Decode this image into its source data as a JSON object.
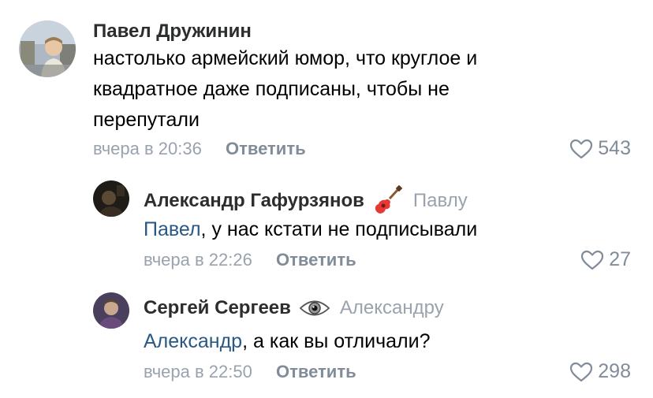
{
  "comments": [
    {
      "author": "Павел Дружинин",
      "reply_to": "",
      "mention": "",
      "text_lines": [
        "настолько армейский юмор, что круглое и",
        "квадратное даже подписаны, чтобы не",
        "перепутали"
      ],
      "time": "вчера в 20:36",
      "reply_label": "Ответить",
      "likes": "543",
      "avatar_icon": "user-photo"
    },
    {
      "author": "Александр Гафурзянов",
      "author_icon": "guitar-icon",
      "reply_to": "Павлу",
      "mention": "Павел",
      "text": ", у нас кстати не подписывали",
      "time": "вчера в 22:26",
      "reply_label": "Ответить",
      "likes": "27",
      "avatar_icon": "user-photo"
    },
    {
      "author": "Сергей Сергеев",
      "author_icon": "eye-icon",
      "reply_to": "Александру",
      "mention": "Александр",
      "text": ", а как вы отличали?",
      "time": "вчера в 22:50",
      "reply_label": "Ответить",
      "likes": "298",
      "avatar_icon": "user-photo"
    }
  ],
  "colors": {
    "link": "#2a5885",
    "meta": "#99a2ad",
    "action": "#818c99"
  },
  "icons": [
    "heart-outline-icon",
    "guitar-icon",
    "eye-icon"
  ]
}
